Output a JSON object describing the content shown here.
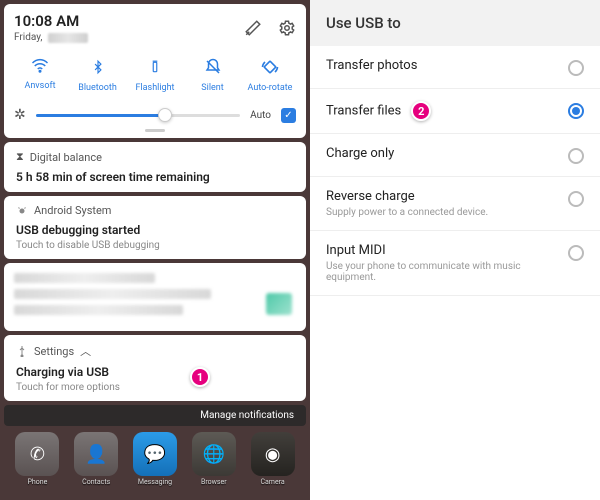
{
  "qs": {
    "time": "10:08 AM",
    "day": "Friday,",
    "tiles": [
      {
        "icon": "wifi",
        "label": "Anvsoft"
      },
      {
        "icon": "bluetooth",
        "label": "Bluetooth"
      },
      {
        "icon": "flashlight",
        "label": "Flashlight"
      },
      {
        "icon": "silent",
        "label": "Silent"
      },
      {
        "icon": "rotate",
        "label": "Auto-rotate"
      }
    ],
    "auto_label": "Auto"
  },
  "cards": {
    "digital": {
      "header": "Digital balance",
      "title": "5 h 58 min of screen time remaining"
    },
    "android": {
      "header": "Android System",
      "title": "USB debugging started",
      "sub": "Touch to disable USB debugging"
    },
    "settings": {
      "header": "Settings",
      "title": "Charging via USB",
      "sub": "Touch for more options"
    }
  },
  "manage": "Manage notifications",
  "dock": [
    {
      "name": "phone",
      "label": "Phone"
    },
    {
      "name": "contacts",
      "label": "Contacts"
    },
    {
      "name": "messaging",
      "label": "Messaging"
    },
    {
      "name": "browser",
      "label": "Browser"
    },
    {
      "name": "camera",
      "label": "Camera"
    }
  ],
  "right": {
    "header": "Use USB to",
    "items": [
      {
        "title": "Transfer photos",
        "sub": "",
        "selected": false
      },
      {
        "title": "Transfer files",
        "sub": "",
        "selected": true,
        "callout": "2"
      },
      {
        "title": "Charge only",
        "sub": "",
        "selected": false
      },
      {
        "title": "Reverse charge",
        "sub": "Supply power to a connected device.",
        "selected": false
      },
      {
        "title": "Input MIDI",
        "sub": "Use your phone to communicate with music equipment.",
        "selected": false
      }
    ]
  },
  "callouts": {
    "c1": "1",
    "c2": "2"
  }
}
